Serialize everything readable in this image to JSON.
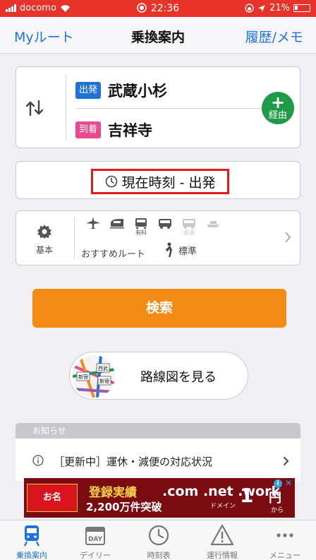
{
  "status_bar": {
    "carrier": "docomo",
    "time": "22:36",
    "battery": "21%"
  },
  "nav": {
    "left_label": "Myルート",
    "title": "乗換案内",
    "right_label": "履歴/メモ"
  },
  "stations": {
    "departure_tag": "出発",
    "departure_name": "武蔵小杉",
    "arrival_tag": "到着",
    "arrival_name": "吉祥寺",
    "via_label": "経由"
  },
  "time_setting": {
    "label": "現在時刻 - 出発"
  },
  "conditions": {
    "basic_label": "基本",
    "modes": [
      {
        "icon": "airplane-icon",
        "label": "",
        "enabled": true
      },
      {
        "icon": "shinkansen-icon",
        "label": "",
        "enabled": true
      },
      {
        "icon": "paid-express-icon",
        "label": "有料",
        "enabled": true
      },
      {
        "icon": "bus-icon",
        "label": "",
        "enabled": true
      },
      {
        "icon": "express-bus-icon",
        "label": "高速",
        "enabled": false
      },
      {
        "icon": "ferry-icon",
        "label": "",
        "enabled": false
      }
    ],
    "route_preference": "おすすめルート",
    "walk_speed": "標準"
  },
  "search_button": "検索",
  "route_map": {
    "label": "路線図を見る",
    "thumb_labels": [
      "新宿",
      "西武",
      "新宿"
    ]
  },
  "news": {
    "header": "お知らせ",
    "items": [
      {
        "text": "［更新中］運休・減便の対応状況"
      }
    ]
  },
  "ad": {
    "logo": "お名前.com",
    "line1": "登録実績",
    "line2": "2,200万件突破",
    "domains": ".com .net .work",
    "sub": "ドメイン",
    "price": "1",
    "yen": "円",
    "suffix": "から"
  },
  "tabbar": {
    "tabs": [
      {
        "label": "乗換案内",
        "icon": "train-icon",
        "active": true
      },
      {
        "label": "デイリー",
        "icon": "calendar-icon",
        "active": false
      },
      {
        "label": "時刻表",
        "icon": "clock-icon",
        "active": false
      },
      {
        "label": "運行情報",
        "icon": "warning-icon",
        "active": false
      },
      {
        "label": "メニュー",
        "icon": "more-icon",
        "active": false
      }
    ],
    "calendar_text": "DAY"
  },
  "colors": {
    "accent": "#1e73d8",
    "status_bar": "#e8332a",
    "search": "#f28a14",
    "departure": "#1e73d8",
    "arrival": "#e84a8d",
    "via": "#1f9a46",
    "highlight": "#e51a1a"
  }
}
